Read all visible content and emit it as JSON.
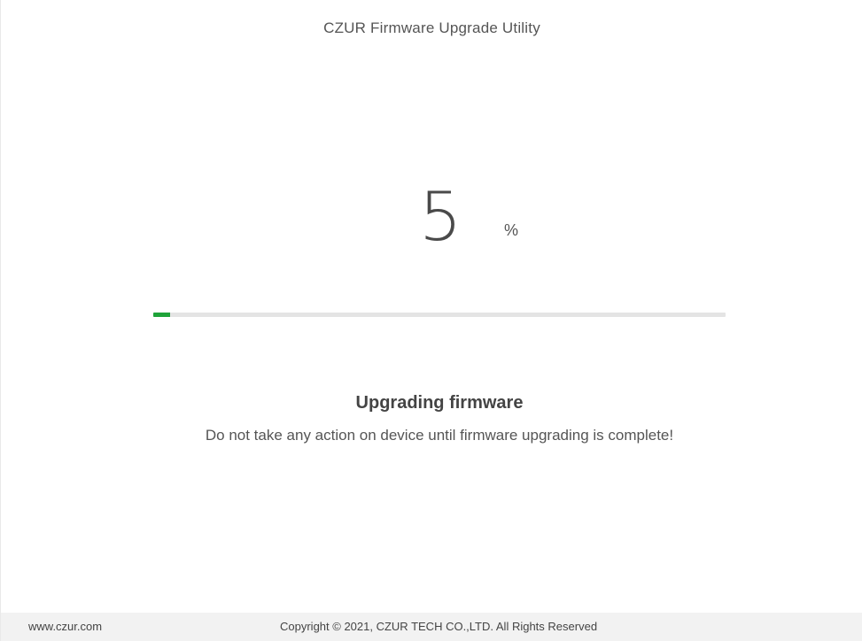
{
  "app": {
    "title": "CZUR Firmware Upgrade Utility"
  },
  "progress": {
    "value_text": "5",
    "unit": "%",
    "percent": 5,
    "fill_color": "#1fa339",
    "track_color": "#e4e4e4"
  },
  "status": {
    "heading": "Upgrading firmware",
    "message": "Do not take any action on device until firmware upgrading is complete!"
  },
  "footer": {
    "website": "www.czur.com",
    "copyright": "Copyright © 2021, CZUR TECH CO.,LTD. All Rights Reserved"
  }
}
